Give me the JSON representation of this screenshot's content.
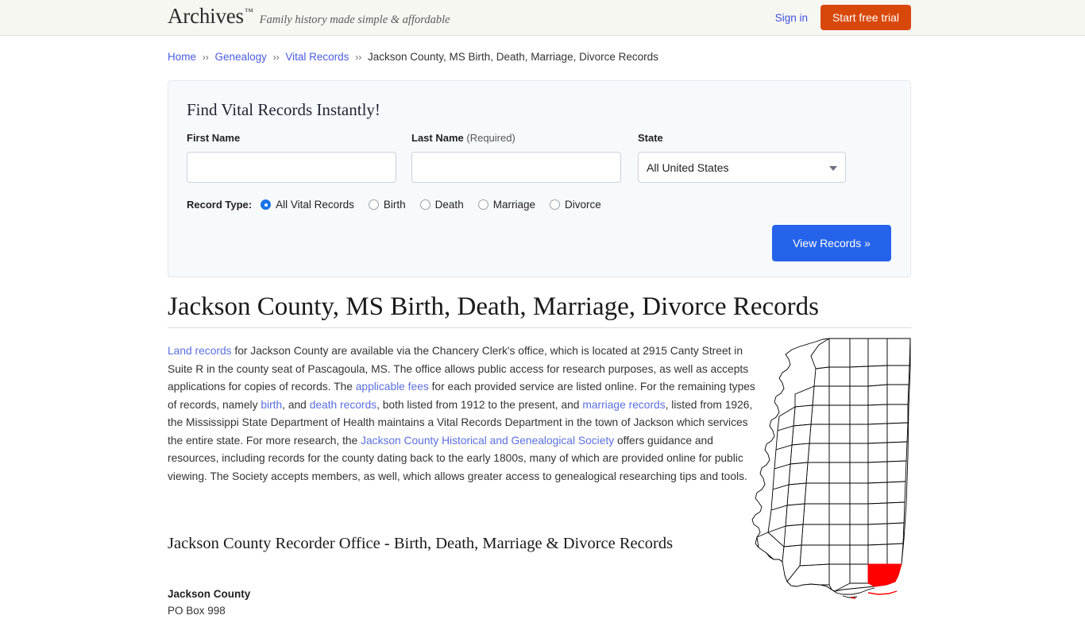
{
  "header": {
    "brand_name": "Archives",
    "brand_tm": "™",
    "tagline": "Family history made simple & affordable",
    "signin_label": "Sign in",
    "trial_label": "Start free trial",
    "background": "#f7f7f2",
    "trial_color": "#d9480b"
  },
  "breadcrumb": {
    "separator": "››",
    "items": [
      {
        "label": "Home",
        "link": true
      },
      {
        "label": "Genealogy",
        "link": true
      },
      {
        "label": "Vital Records",
        "link": true
      },
      {
        "label": "Jackson County, MS Birth, Death, Marriage, Divorce Records",
        "link": false
      }
    ]
  },
  "search_panel": {
    "title": "Find Vital Records Instantly!",
    "first_name": {
      "label": "First Name",
      "value": "",
      "placeholder": ""
    },
    "last_name": {
      "label": "Last Name",
      "required_note": "(Required)",
      "value": "",
      "placeholder": ""
    },
    "state": {
      "label": "State",
      "selected": "All United States",
      "caret_icon": "chevron-down-icon"
    },
    "record_type": {
      "label": "Record Type:",
      "selected": "All Vital Records",
      "options": [
        "All Vital Records",
        "Birth",
        "Death",
        "Marriage",
        "Divorce"
      ]
    },
    "submit_label": "View Records »",
    "submit_color": "#2563eb",
    "background": "#f7fafd"
  },
  "main": {
    "page_title": "Jackson County, MS Birth, Death, Marriage, Divorce Records",
    "paragraph_parts": [
      {
        "text": "Land records",
        "link": true
      },
      {
        "text": " for Jackson County are available via the Chancery Clerk's office, which is located at 2915 Canty Street in Suite R in the county seat of Pascagoula, MS. The office allows public access for research purposes, as well as accepts applications for copies of records. The ",
        "link": false
      },
      {
        "text": "applicable fees",
        "link": true
      },
      {
        "text": " for each provided service are listed online. For the remaining types of records, namely ",
        "link": false
      },
      {
        "text": "birth",
        "link": true
      },
      {
        "text": ", and ",
        "link": false
      },
      {
        "text": "death records",
        "link": true
      },
      {
        "text": ", both listed from 1912 to the present, and ",
        "link": false
      },
      {
        "text": "marriage records",
        "link": true
      },
      {
        "text": ", listed from 1926, the Mississippi State Department of Health maintains a Vital Records Department in the town of Jackson which services the entire state. For more research, the ",
        "link": false
      },
      {
        "text": "Jackson County Historical and Genealogical Society",
        "link": true
      },
      {
        "text": " offers guidance and resources, including records for the county dating back to the early 1800s, many of which are provided online for public viewing. The Society accepts members, as well, which allows greater access to genealogical researching tips and tools.",
        "link": false
      }
    ],
    "subheading": "Jackson County Recorder Office - Birth, Death, Marriage & Divorce Records",
    "office": {
      "name": "Jackson County",
      "address_line": "PO Box 998"
    },
    "link_color": "#5b6fe0"
  },
  "map": {
    "name": "mississippi-county-map",
    "state": "Mississippi",
    "highlighted_county": "Jackson County",
    "highlight_color": "#ff0000",
    "outline_color": "#000000",
    "fill_color": "#ffffff"
  }
}
